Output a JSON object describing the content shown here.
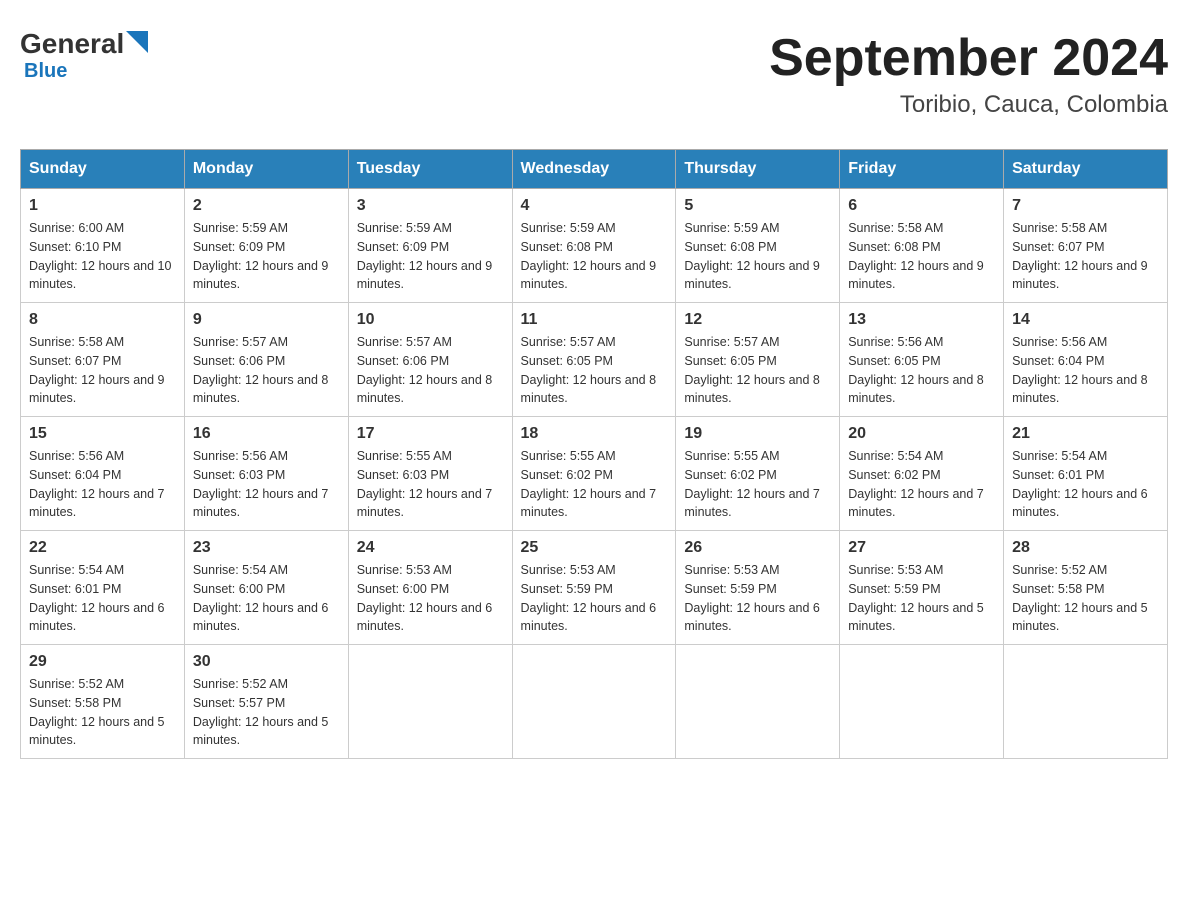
{
  "header": {
    "logo_general": "General",
    "logo_blue": "Blue",
    "month_title": "September 2024",
    "location": "Toribio, Cauca, Colombia"
  },
  "weekdays": [
    "Sunday",
    "Monday",
    "Tuesday",
    "Wednesday",
    "Thursday",
    "Friday",
    "Saturday"
  ],
  "weeks": [
    [
      {
        "day": "1",
        "sunrise": "6:00 AM",
        "sunset": "6:10 PM",
        "daylight": "12 hours and 10 minutes."
      },
      {
        "day": "2",
        "sunrise": "5:59 AM",
        "sunset": "6:09 PM",
        "daylight": "12 hours and 9 minutes."
      },
      {
        "day": "3",
        "sunrise": "5:59 AM",
        "sunset": "6:09 PM",
        "daylight": "12 hours and 9 minutes."
      },
      {
        "day": "4",
        "sunrise": "5:59 AM",
        "sunset": "6:08 PM",
        "daylight": "12 hours and 9 minutes."
      },
      {
        "day": "5",
        "sunrise": "5:59 AM",
        "sunset": "6:08 PM",
        "daylight": "12 hours and 9 minutes."
      },
      {
        "day": "6",
        "sunrise": "5:58 AM",
        "sunset": "6:08 PM",
        "daylight": "12 hours and 9 minutes."
      },
      {
        "day": "7",
        "sunrise": "5:58 AM",
        "sunset": "6:07 PM",
        "daylight": "12 hours and 9 minutes."
      }
    ],
    [
      {
        "day": "8",
        "sunrise": "5:58 AM",
        "sunset": "6:07 PM",
        "daylight": "12 hours and 9 minutes."
      },
      {
        "day": "9",
        "sunrise": "5:57 AM",
        "sunset": "6:06 PM",
        "daylight": "12 hours and 8 minutes."
      },
      {
        "day": "10",
        "sunrise": "5:57 AM",
        "sunset": "6:06 PM",
        "daylight": "12 hours and 8 minutes."
      },
      {
        "day": "11",
        "sunrise": "5:57 AM",
        "sunset": "6:05 PM",
        "daylight": "12 hours and 8 minutes."
      },
      {
        "day": "12",
        "sunrise": "5:57 AM",
        "sunset": "6:05 PM",
        "daylight": "12 hours and 8 minutes."
      },
      {
        "day": "13",
        "sunrise": "5:56 AM",
        "sunset": "6:05 PM",
        "daylight": "12 hours and 8 minutes."
      },
      {
        "day": "14",
        "sunrise": "5:56 AM",
        "sunset": "6:04 PM",
        "daylight": "12 hours and 8 minutes."
      }
    ],
    [
      {
        "day": "15",
        "sunrise": "5:56 AM",
        "sunset": "6:04 PM",
        "daylight": "12 hours and 7 minutes."
      },
      {
        "day": "16",
        "sunrise": "5:56 AM",
        "sunset": "6:03 PM",
        "daylight": "12 hours and 7 minutes."
      },
      {
        "day": "17",
        "sunrise": "5:55 AM",
        "sunset": "6:03 PM",
        "daylight": "12 hours and 7 minutes."
      },
      {
        "day": "18",
        "sunrise": "5:55 AM",
        "sunset": "6:02 PM",
        "daylight": "12 hours and 7 minutes."
      },
      {
        "day": "19",
        "sunrise": "5:55 AM",
        "sunset": "6:02 PM",
        "daylight": "12 hours and 7 minutes."
      },
      {
        "day": "20",
        "sunrise": "5:54 AM",
        "sunset": "6:02 PM",
        "daylight": "12 hours and 7 minutes."
      },
      {
        "day": "21",
        "sunrise": "5:54 AM",
        "sunset": "6:01 PM",
        "daylight": "12 hours and 6 minutes."
      }
    ],
    [
      {
        "day": "22",
        "sunrise": "5:54 AM",
        "sunset": "6:01 PM",
        "daylight": "12 hours and 6 minutes."
      },
      {
        "day": "23",
        "sunrise": "5:54 AM",
        "sunset": "6:00 PM",
        "daylight": "12 hours and 6 minutes."
      },
      {
        "day": "24",
        "sunrise": "5:53 AM",
        "sunset": "6:00 PM",
        "daylight": "12 hours and 6 minutes."
      },
      {
        "day": "25",
        "sunrise": "5:53 AM",
        "sunset": "5:59 PM",
        "daylight": "12 hours and 6 minutes."
      },
      {
        "day": "26",
        "sunrise": "5:53 AM",
        "sunset": "5:59 PM",
        "daylight": "12 hours and 6 minutes."
      },
      {
        "day": "27",
        "sunrise": "5:53 AM",
        "sunset": "5:59 PM",
        "daylight": "12 hours and 5 minutes."
      },
      {
        "day": "28",
        "sunrise": "5:52 AM",
        "sunset": "5:58 PM",
        "daylight": "12 hours and 5 minutes."
      }
    ],
    [
      {
        "day": "29",
        "sunrise": "5:52 AM",
        "sunset": "5:58 PM",
        "daylight": "12 hours and 5 minutes."
      },
      {
        "day": "30",
        "sunrise": "5:52 AM",
        "sunset": "5:57 PM",
        "daylight": "12 hours and 5 minutes."
      },
      null,
      null,
      null,
      null,
      null
    ]
  ]
}
